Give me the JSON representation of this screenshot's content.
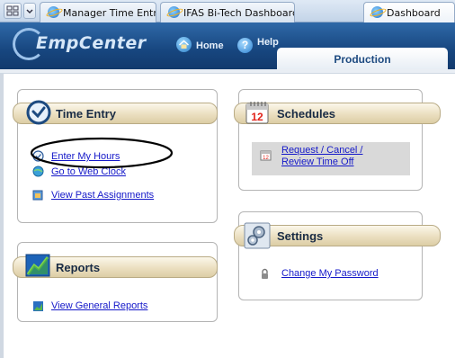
{
  "browser": {
    "tabs": [
      {
        "label": "Manager Time Entry"
      },
      {
        "label": "IFAS Bi-Tech Dashboard"
      },
      {
        "label": "Dashboard"
      }
    ]
  },
  "header": {
    "logo_text": "EmpCenter",
    "home_label": "Home",
    "help_label": "Help",
    "environment_label": "Production",
    "help_glyph": "?"
  },
  "portlets": {
    "time_entry": {
      "title": "Time Entry",
      "links": [
        "Enter My Hours",
        "Go to Web Clock",
        "View Past Assignments"
      ]
    },
    "schedules": {
      "title": "Schedules",
      "calendar_day": "12",
      "links": [
        "Request / Cancel /",
        "Review Time Off"
      ]
    },
    "settings": {
      "title": "Settings",
      "links": [
        "Change My Password"
      ]
    },
    "reports": {
      "title": "Reports",
      "links": [
        "View General Reports"
      ]
    }
  },
  "icons": {
    "tab_strip": "tab-thumbnails-icon",
    "tab_list": "tab-list-chevron-icon",
    "browser_tab": "internet-explorer-icon",
    "home": "home-icon",
    "help": "help-icon",
    "time_entry": "clock-icon",
    "schedules": "calendar-icon",
    "settings": "gears-icon",
    "reports": "chart-icon",
    "enter_hours": "clock-small-icon",
    "web_clock": "globe-clock-icon",
    "past_assignments": "document-icon",
    "time_off": "calendar-small-icon",
    "change_password": "lock-icon",
    "general_reports": "report-icon"
  },
  "colors": {
    "header": "#1f4f8a",
    "link": "#1418c9",
    "portlet_title": "#ebdfc0",
    "highlight": "#d9d9d9",
    "annotation": "#000000"
  }
}
